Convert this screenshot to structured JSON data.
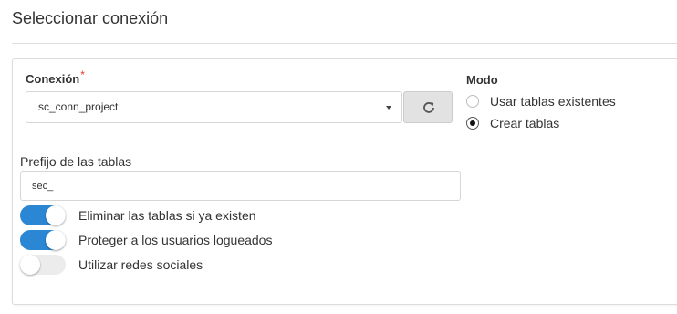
{
  "header": {
    "title": "Seleccionar conexión"
  },
  "connection": {
    "label": "Conexión",
    "required_mark": "*",
    "selected_value": "sc_conn_project"
  },
  "mode": {
    "label": "Modo",
    "options": [
      {
        "label": "Usar tablas existentes",
        "checked": false
      },
      {
        "label": "Crear tablas",
        "checked": true
      }
    ]
  },
  "prefix": {
    "label": "Prefijo de las tablas",
    "value": "sec_"
  },
  "toggles": [
    {
      "label": "Eliminar las tablas si ya existen",
      "on": true
    },
    {
      "label": "Proteger a los usuarios logueados",
      "on": true
    },
    {
      "label": "Utilizar redes sociales",
      "on": false
    }
  ],
  "icons": {
    "refresh": "refresh-icon",
    "caret": "chevron-down-icon"
  },
  "colors": {
    "toggle_on": "#2b87d3",
    "required": "#e53935"
  }
}
